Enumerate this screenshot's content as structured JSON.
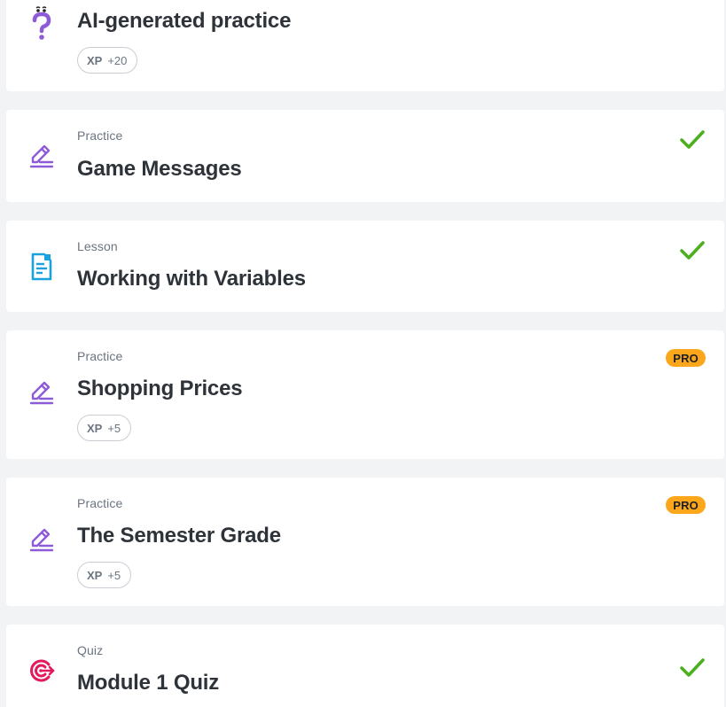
{
  "colors": {
    "background": "#f1f3f5",
    "card": "#ffffff",
    "practice_icon": "#8e5bd8",
    "lesson_icon": "#1ba1de",
    "quiz_icon": "#e2195c",
    "check": "#4caf1e",
    "pro_badge": "#fba61b"
  },
  "items": [
    {
      "icon": "question-mark-icon",
      "kind": "",
      "title": "AI-generated practice",
      "xp_label": "XP",
      "xp_value": "+20",
      "completed": false,
      "pro": false
    },
    {
      "icon": "pencil-icon",
      "kind": "Practice",
      "title": "Game Messages",
      "completed": true,
      "pro": false
    },
    {
      "icon": "document-icon",
      "kind": "Lesson",
      "title": "Working with Variables",
      "completed": true,
      "pro": false
    },
    {
      "icon": "pencil-icon",
      "kind": "Practice",
      "title": "Shopping Prices",
      "xp_label": "XP",
      "xp_value": "+5",
      "completed": false,
      "pro": true,
      "pro_label": "PRO"
    },
    {
      "icon": "pencil-icon",
      "kind": "Practice",
      "title": "The Semester Grade",
      "xp_label": "XP",
      "xp_value": "+5",
      "completed": false,
      "pro": true,
      "pro_label": "PRO"
    },
    {
      "icon": "target-icon",
      "kind": "Quiz",
      "title": "Module 1 Quiz",
      "completed": true,
      "pro": false
    }
  ]
}
